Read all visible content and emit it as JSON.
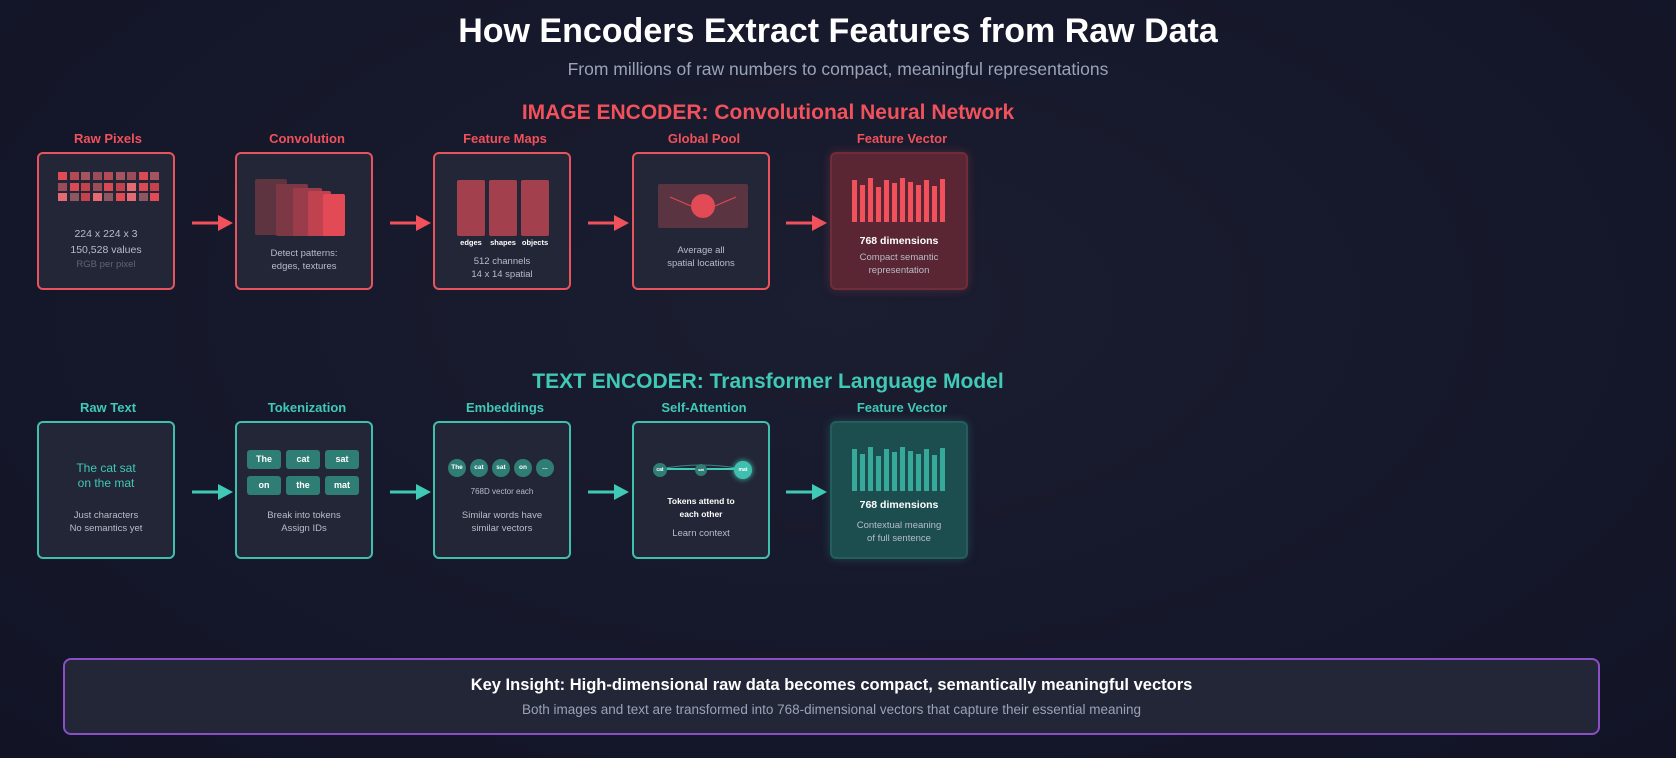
{
  "title": "How Encoders Extract Features from Raw Data",
  "subtitle": "From millions of raw numbers to compact, meaningful representations",
  "colors": {
    "image_accent": "#f0515b",
    "text_accent": "#3fc9b6",
    "insight_border": "#8a4fc7",
    "background": "#15172a"
  },
  "image_encoder": {
    "section_title": "IMAGE ENCODER: Convolutional Neural Network",
    "stages": [
      {
        "label": "Raw Pixels",
        "lines": [
          "224 x 224 x 3",
          "150,528 values",
          "RGB per pixel"
        ]
      },
      {
        "label": "Convolution",
        "lines": [
          "Detect patterns:",
          "edges, textures"
        ]
      },
      {
        "label": "Feature Maps",
        "map_labels": [
          "edges",
          "shapes",
          "objects"
        ],
        "lines": [
          "512 channels",
          "14 x 14 spatial"
        ]
      },
      {
        "label": "Global Pool",
        "lines": [
          "Average all",
          "spatial locations"
        ]
      },
      {
        "label": "Feature Vector",
        "lines": [
          "768 dimensions",
          "Compact semantic",
          "representation"
        ]
      }
    ]
  },
  "text_encoder": {
    "section_title": "TEXT ENCODER: Transformer Language Model",
    "stages": [
      {
        "label": "Raw Text",
        "sample_lines": [
          "The cat sat",
          "on the mat"
        ],
        "lines": [
          "Just characters",
          "No semantics yet"
        ]
      },
      {
        "label": "Tokenization",
        "tokens": [
          "The",
          "cat",
          "sat",
          "on",
          "the",
          "mat"
        ],
        "lines": [
          "Break into tokens",
          "Assign IDs"
        ]
      },
      {
        "label": "Embeddings",
        "embeddings": [
          "The",
          "cat",
          "sat",
          "on",
          "..."
        ],
        "lines": [
          "768D vector each",
          "Similar words have",
          "similar vectors"
        ]
      },
      {
        "label": "Self-Attention",
        "nodes": [
          "cat",
          "sat",
          "mat"
        ],
        "lines": [
          "Tokens attend to",
          "each other",
          "Learn context"
        ]
      },
      {
        "label": "Feature Vector",
        "lines": [
          "768 dimensions",
          "Contextual meaning",
          "of full sentence"
        ]
      }
    ]
  },
  "insight": {
    "title": "Key Insight: High-dimensional raw data becomes compact, semantically meaningful vectors",
    "text": "Both images and text are transformed into 768-dimensional vectors that capture their essential meaning"
  }
}
